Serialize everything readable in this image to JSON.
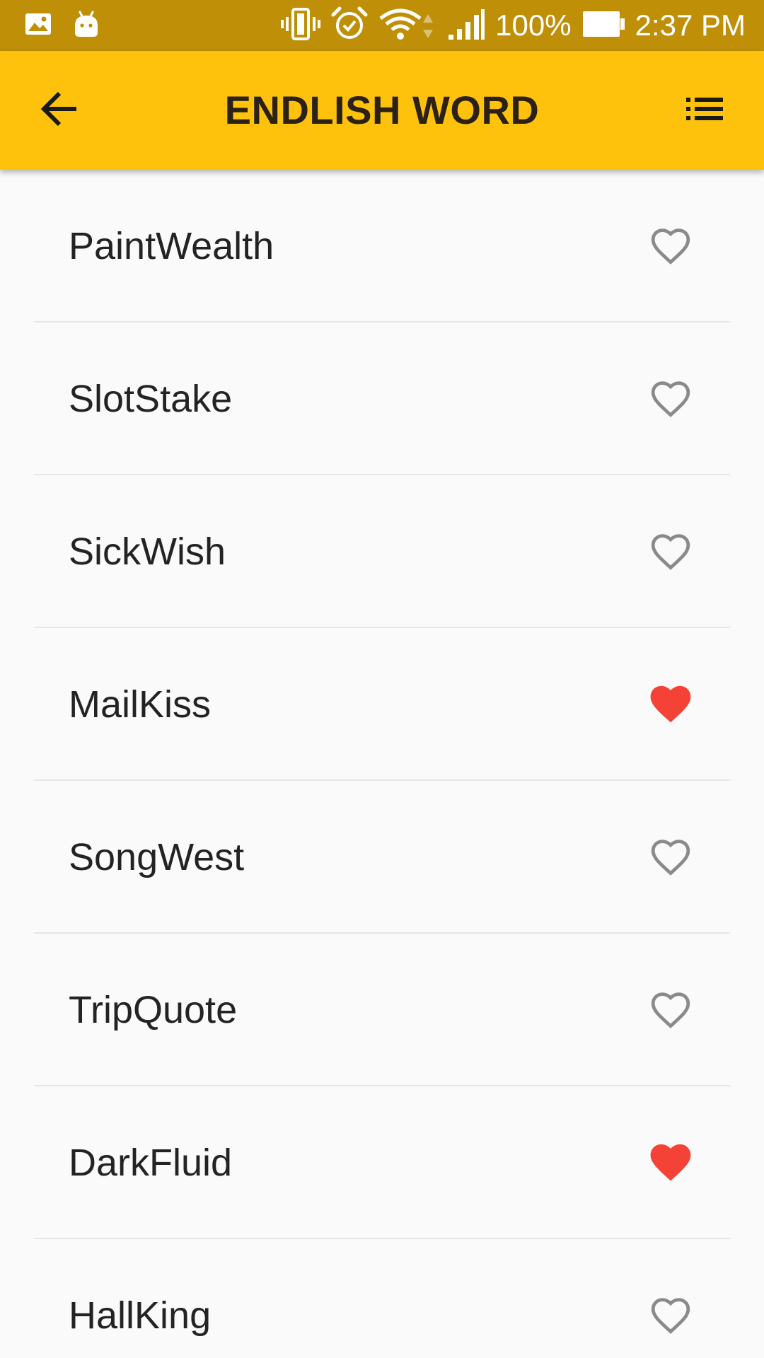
{
  "status_bar": {
    "battery": "100%",
    "time": "2:37 PM",
    "icons": [
      "gallery-icon",
      "android-icon",
      "vibrate-icon",
      "alarm-icon",
      "wifi-icon",
      "signal-icon",
      "battery-icon"
    ]
  },
  "app_bar": {
    "title": "ENDLISH WORD",
    "back_icon": "back-arrow-icon",
    "menu_icon": "list-icon"
  },
  "colors": {
    "status_bar": "#bf8f07",
    "app_bar": "#fec20c",
    "favorite_on": "#f44336",
    "favorite_off": "#8a8a8a"
  },
  "words": [
    {
      "label": "PaintWealth",
      "favorite": false
    },
    {
      "label": "SlotStake",
      "favorite": false
    },
    {
      "label": "SickWish",
      "favorite": false
    },
    {
      "label": "MailKiss",
      "favorite": true
    },
    {
      "label": "SongWest",
      "favorite": false
    },
    {
      "label": "TripQuote",
      "favorite": false
    },
    {
      "label": "DarkFluid",
      "favorite": true
    },
    {
      "label": "HallKing",
      "favorite": false
    }
  ]
}
